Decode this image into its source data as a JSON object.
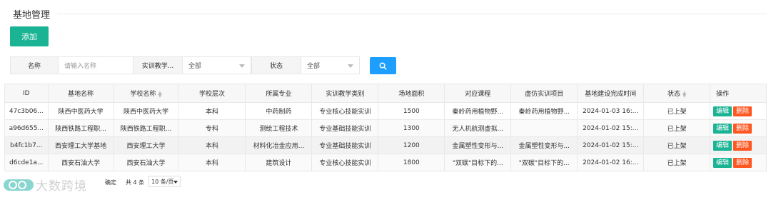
{
  "header": {
    "title": "基地管理"
  },
  "toolbar": {
    "add_label": "添加"
  },
  "filters": {
    "name_label": "名称",
    "name_placeholder": "请输入名称",
    "category_label": "实训教学...",
    "category_value": "全部",
    "status_label": "状态",
    "status_value": "全部",
    "search_icon": "search-icon"
  },
  "table": {
    "headers": [
      "ID",
      "基地名称",
      "学校名称",
      "学校层次",
      "所属专业",
      "实训教学类别",
      "场地面积",
      "对应课程",
      "虚仿实训项目",
      "基地建设完成时间",
      "状态",
      "操作"
    ],
    "rows": [
      [
        "47c3b06...",
        "陕西中医药大学",
        "陕西中医药大学",
        "本科",
        "中药制药",
        "专业核心技能实训",
        "1500",
        "秦岭药用植物野...",
        "秦岭药用植物野...",
        "2024-01-03 16:...",
        "已上架"
      ],
      [
        "a96d655...",
        "陕西铁路工程职...",
        "陕西铁路工程职...",
        "专科",
        "测绘工程技术",
        "专业基础技能实训",
        "1300",
        "无人机航测虚拟...",
        "",
        "2024-01-02 15:...",
        "已上架"
      ],
      [
        "b4fc1b7...",
        "西安理工大学基地",
        "西安理工大学",
        "本科",
        "材料化冶金应用...",
        "专业基础技能实训",
        "1200",
        "金属塑性变形与...",
        "金属塑性变形与...",
        "2024-01-02 15:...",
        "已上架"
      ],
      [
        "d6cde1a...",
        "西安石油大学",
        "西安石油大学",
        "本科",
        "建筑设计",
        "专业核心技能实训",
        "1800",
        "\"双碳\"目标下的...",
        "\"双碳\"目标下的...",
        "2024-01-02 16:...",
        "已上架"
      ]
    ],
    "edit_label": "编辑",
    "delete_label": "删除"
  },
  "pager": {
    "confirm_label": "确定",
    "total_label": "共 4 条",
    "page_size": "10 条/页"
  },
  "watermark": {
    "text": "大数跨境"
  },
  "colors": {
    "primary": "#1ab394",
    "danger": "#ff5722",
    "search": "#1e9fff"
  }
}
